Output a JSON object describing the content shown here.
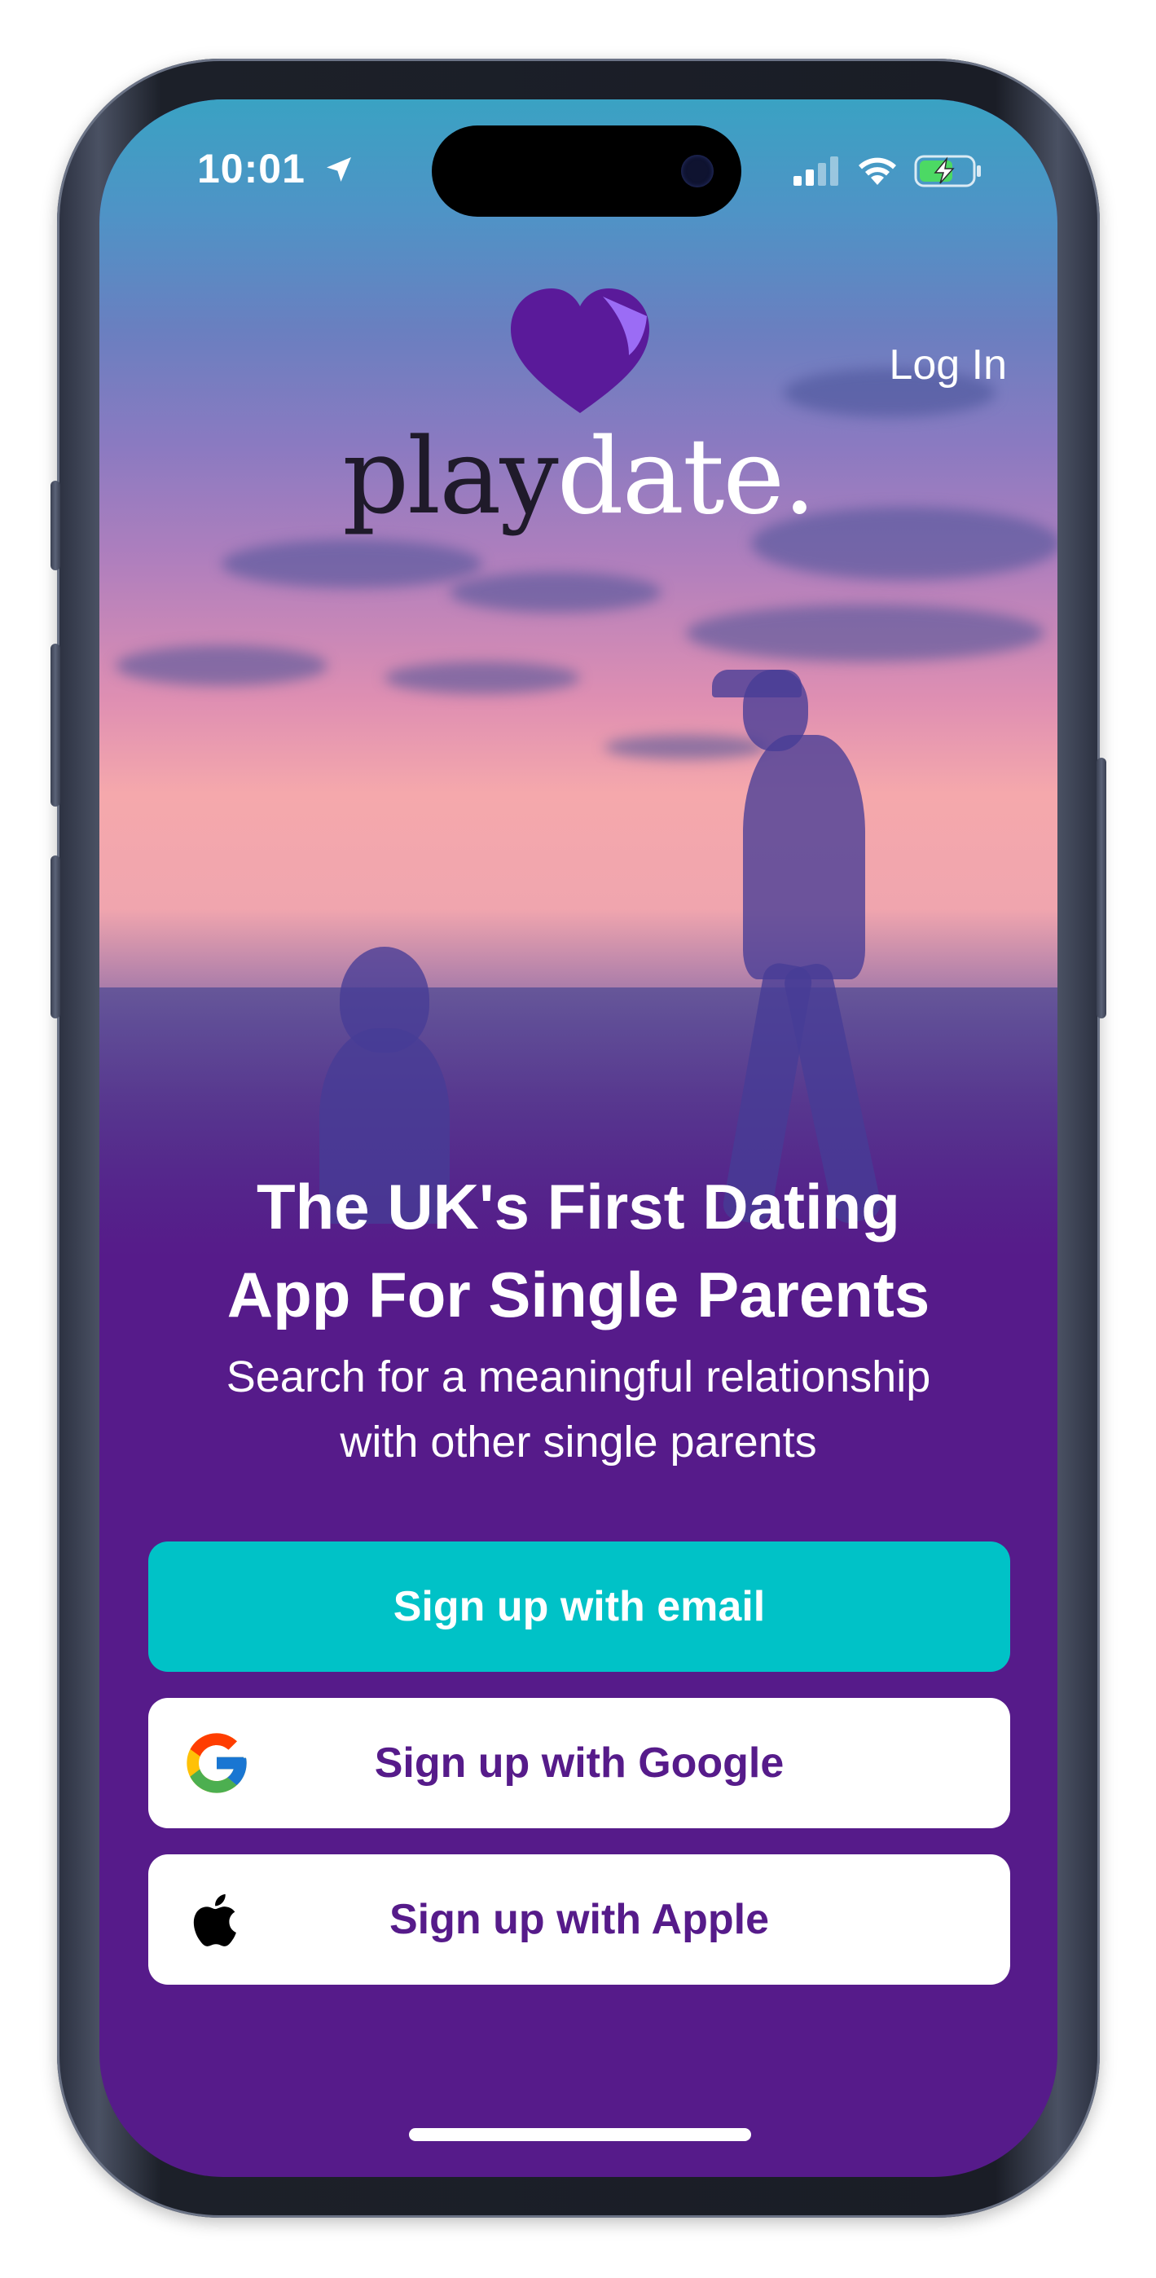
{
  "status_bar": {
    "time": "10:01",
    "icons": [
      "location-arrow-icon",
      "cellular-signal-icon",
      "wifi-icon",
      "battery-charging-icon"
    ]
  },
  "brand": {
    "logo_icon": "heart-icon",
    "name_part1": "play",
    "name_part2": "date."
  },
  "header": {
    "login_label": "Log In"
  },
  "hero": {
    "headline_line1": "The UK's First Dating",
    "headline_line2": "App For Single Parents",
    "subhead_line1": "Search for a meaningful relationship",
    "subhead_line2": "with other single parents"
  },
  "actions": {
    "email_label": "Sign up with email",
    "google_label": "Sign up with Google",
    "google_icon": "google-g-icon",
    "apple_label": "Sign up with Apple",
    "apple_icon": "apple-logo-icon"
  },
  "colors": {
    "brand_purple": "#561b8a",
    "accent_teal": "#00c2c7",
    "heart_purple": "#5a1a9a",
    "heart_fold": "#9b6cf5"
  }
}
